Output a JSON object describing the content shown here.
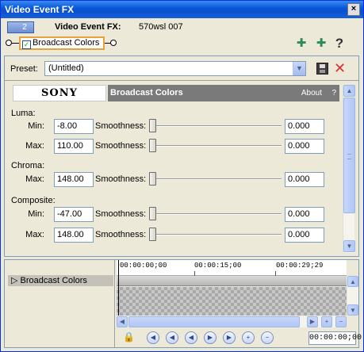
{
  "window": {
    "title": "Video Event FX",
    "close_label": "×"
  },
  "header": {
    "badge_number": "2",
    "label": "Video Event FX:",
    "event_name": "570wsl 007"
  },
  "chain": {
    "fx_name": "Broadcast Colors",
    "checked_mark": "✓",
    "icons": [
      "add-plugin-icon",
      "remove-plugin-icon",
      "help-icon"
    ],
    "help_glyph": "?",
    "add_glyph": "✚",
    "remove_glyph": "✚"
  },
  "preset": {
    "label": "Preset:",
    "value": "(Untitled)",
    "dropdown_glyph": "▼",
    "delete_glyph": "✕"
  },
  "plugin": {
    "brand": "SONY",
    "title": "Broadcast Colors",
    "about": "About",
    "help": "?",
    "groups": {
      "luma": {
        "label": "Luma:",
        "min": {
          "label": "Min:",
          "value": "-8.00",
          "smooth_label": "Smoothness:",
          "smooth_value": "0.000"
        },
        "max": {
          "label": "Max:",
          "value": "110.00",
          "smooth_label": "Smoothness:",
          "smooth_value": "0.000"
        }
      },
      "chroma": {
        "label": "Chroma:",
        "max": {
          "label": "Max:",
          "value": "148.00",
          "smooth_label": "Smoothness:",
          "smooth_value": "0.000"
        }
      },
      "composite": {
        "label": "Composite:",
        "min": {
          "label": "Min:",
          "value": "-47.00",
          "smooth_label": "Smoothness:",
          "smooth_value": "0.000"
        },
        "max": {
          "label": "Max:",
          "value": "148.00",
          "smooth_label": "Smoothness:",
          "smooth_value": "0.000"
        }
      }
    }
  },
  "scrollbar": {
    "up_glyph": "▲",
    "down_glyph": "▼"
  },
  "timeline": {
    "track_item": "Broadcast Colors",
    "expand_glyph": "▷",
    "ruler": [
      "00:00:00;00",
      "00:00:15;00",
      "00:00:29;29"
    ],
    "timecode": "00:00:00;00",
    "hscroll": {
      "left_glyph": "◀",
      "right_glyph": "▶",
      "plus": "+",
      "minus": "−"
    },
    "transport_buttons": [
      "sync-cursor-icon",
      "first-keyframe-icon",
      "prev-keyframe-icon",
      "next-keyframe-icon",
      "last-keyframe-icon",
      "add-keyframe-icon",
      "delete-keyframe-icon"
    ],
    "transport_glyphs": [
      "◀",
      "◀",
      "◀",
      "▶",
      "▶",
      "+",
      "−"
    ],
    "lock_glyph": "🔒"
  }
}
